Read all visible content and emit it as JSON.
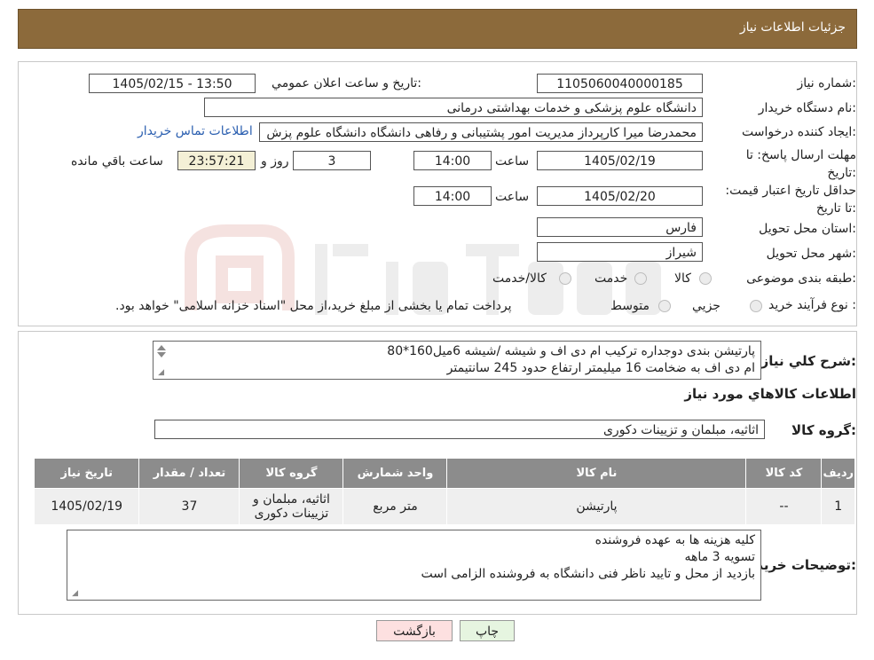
{
  "header": {
    "title": "جزئیات اطلاعات نیاز"
  },
  "form": {
    "need_number": {
      "label": "شماره نیاز:",
      "value": "1105060040000185"
    },
    "announce": {
      "label": "تاریخ و ساعت اعلان عمومي:",
      "value": "1405/02/15 - 13:50"
    },
    "buyer_org": {
      "label": "نام دستگاه خریدار:",
      "value": "دانشگاه علوم پزشکی و خدمات بهداشتی درمانی"
    },
    "requester": {
      "label": "ایجاد کننده درخواست:",
      "value": "محمدرضا میرا کارپرداز مدیریت امور پشتیبانی و رفاهی دانشگاه دانشگاه علوم پزش",
      "contact_link": "اطلاعات تماس خریدار"
    },
    "deadline": {
      "label": "مهلت ارسال پاسخ: تا تاریخ:",
      "date": "1405/02/19",
      "time_label": "ساعت",
      "time": "14:00",
      "days": "3",
      "days_label": "روز و",
      "remaining": "23:57:21",
      "remaining_label": "ساعت باقي مانده"
    },
    "validity": {
      "label": "حداقل تاریخ اعتبار قیمت: تا تاریخ:",
      "date": "1405/02/20",
      "time_label": "ساعت",
      "time": "14:00"
    },
    "province": {
      "label": "استان محل تحویل:",
      "value": "فارس"
    },
    "city": {
      "label": "شهر محل تحویل:",
      "value": "شیراز"
    },
    "category": {
      "label": "طبقه بندی موضوعی:",
      "options": [
        "کالا",
        "خدمت",
        "کالا/خدمت"
      ]
    },
    "process": {
      "label": "نوع فرآیند خرید :",
      "options": [
        "جزیي",
        "متوسط"
      ],
      "note": "پرداخت تمام یا بخشی از مبلغ خرید،از محل \"اسناد خزانه اسلامی\" خواهد بود."
    }
  },
  "description": {
    "label": "شرح کلي نیاز:",
    "lines": [
      "پارتیشن بندی دوجداره ترکیب ام دی اف و شیشه /شیشه 6میل160*80",
      "ام دی اف به ضخامت 16 میلیمتر ارتفاع حدود 245 سانتیمتر"
    ]
  },
  "goods_section": {
    "title": "اطلاعات کالاهاي مورد نیاز"
  },
  "goods_group": {
    "label": "گروه کالا:",
    "value": "اثاثیه، مبلمان و تزیینات دکوری"
  },
  "table": {
    "headers": [
      "ردیف",
      "کد کالا",
      "نام کالا",
      "واحد شمارش",
      "گروه کالا",
      "تعداد / مقدار",
      "تاریخ نیاز"
    ],
    "rows": [
      [
        "1",
        "--",
        "پارتیشن",
        "متر مربع",
        "اثاثیه، مبلمان و تزیینات دکوری",
        "37",
        "1405/02/19"
      ]
    ]
  },
  "buyer_notes": {
    "label": "توضیحات خریدار:",
    "lines": [
      "کلیه هزینه ها به عهده فروشنده",
      "تسویه 3 ماهه",
      "بازدید از محل و تایید ناظر فنی دانشگاه به فروشنده الزامی است"
    ]
  },
  "buttons": {
    "print": "چاپ",
    "back": "بازگشت"
  },
  "colors": {
    "header_bg": "#8c6a3b",
    "table_header_bg": "#8c8c8c",
    "link": "#2b5fb0",
    "back_button_bg": "#fde0e0",
    "print_button_bg": "#e6f5e0"
  }
}
